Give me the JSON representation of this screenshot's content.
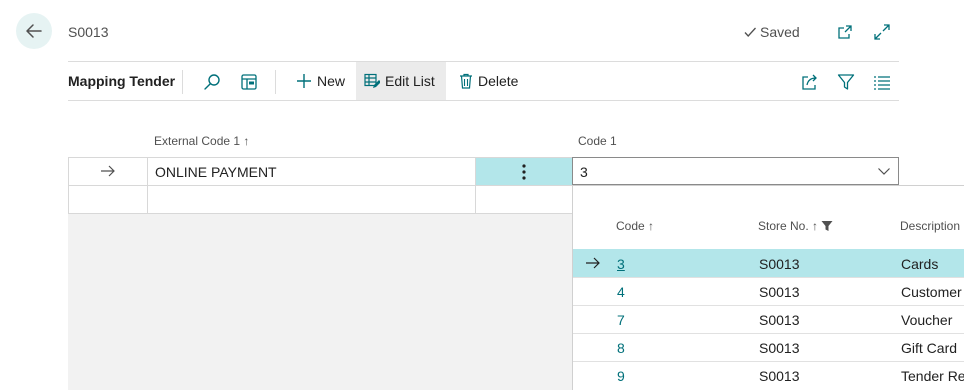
{
  "header": {
    "record_title": "S0013",
    "saved_status": "Saved"
  },
  "actionbar": {
    "page_name": "Mapping Tender",
    "new_label": "New",
    "edit_list_label": "Edit List",
    "delete_label": "Delete"
  },
  "grid": {
    "col_external_code": "External Code 1 ↑",
    "col_code": "Code 1",
    "rows": [
      {
        "external_code": "ONLINE PAYMENT",
        "code": "3"
      }
    ]
  },
  "lookup": {
    "headers": {
      "code": "Code ↑",
      "store_no": "Store No. ↑",
      "description": "Description"
    },
    "rows": [
      {
        "code": "3",
        "store_no": "S0013",
        "description": "Cards"
      },
      {
        "code": "4",
        "store_no": "S0013",
        "description": "Customer"
      },
      {
        "code": "7",
        "store_no": "S0013",
        "description": "Voucher"
      },
      {
        "code": "8",
        "store_no": "S0013",
        "description": "Gift Card"
      },
      {
        "code": "9",
        "store_no": "S0013",
        "description": "Tender Rem"
      }
    ]
  },
  "colors": {
    "accent": "#00707a",
    "selected_row": "#b3e6ea",
    "back_button_bg": "#e6f3f3"
  },
  "icons": [
    "back-arrow-icon",
    "checkmark-icon",
    "open-new-window-icon",
    "expand-icon",
    "search-icon",
    "filter-pane-icon",
    "plus-icon",
    "edit-list-icon",
    "delete-icon",
    "share-icon",
    "filter-icon",
    "list-view-icon",
    "row-arrow-icon",
    "more-options-icon",
    "chevron-down-icon"
  ]
}
